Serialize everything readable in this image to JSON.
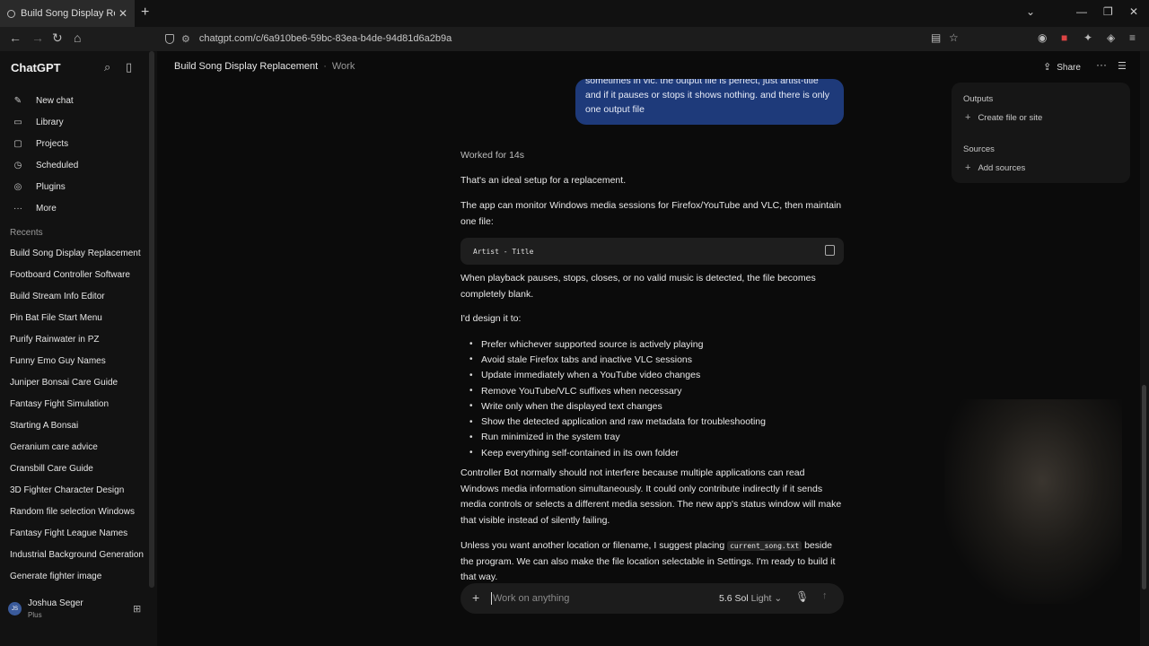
{
  "browser": {
    "tab_title": "Build Song Display Replacement",
    "url": "chatgpt.com/c/6a910be6-59bc-83ea-b4de-94d81d6a2b9a",
    "icons": [
      "back-icon",
      "forward-icon",
      "reload-icon",
      "home-icon",
      "shield-icon",
      "bookmark-icon",
      "star-icon"
    ]
  },
  "sidebar": {
    "brand": "ChatGPT",
    "nav": [
      {
        "label": "New chat",
        "icon": "edit-icon"
      },
      {
        "label": "Library",
        "icon": "library-icon"
      },
      {
        "label": "Projects",
        "icon": "folder-icon"
      },
      {
        "label": "Scheduled",
        "icon": "clock-icon"
      },
      {
        "label": "Plugins",
        "icon": "plugin-icon"
      },
      {
        "label": "More",
        "icon": "more-icon"
      }
    ],
    "recents_heading": "Recents",
    "recents": [
      "Build Song Display Replacement",
      "Footboard Controller Software",
      "Build Stream Info Editor",
      "Pin Bat File Start Menu",
      "Purify Rainwater in PZ",
      "Funny Emo Guy Names",
      "Juniper Bonsai Care Guide",
      "Fantasy Fight Simulation",
      "Starting A Bonsai",
      "Geranium care advice",
      "Cransbill Care Guide",
      "3D Fighter Character Design",
      "Random file selection Windows",
      "Fantasy Fight League Names",
      "Industrial Background Generation",
      "Generate fighter image"
    ],
    "user": {
      "name": "Joshua Seger",
      "plan": "Plus",
      "initials": "JS"
    }
  },
  "header": {
    "title": "Build Song Display Replacement",
    "separator": "·",
    "project": "Work",
    "share_label": "Share"
  },
  "conversation": {
    "user_message_lines": [
      "sometimes in vlc. the output file is perfect, just artist-title",
      "and if it pauses or stops it shows nothing. and there is only",
      "one output file"
    ],
    "worked_label": "Worked for 14s",
    "p1": "That's an ideal setup for a replacement.",
    "p2": "The app can monitor Windows media sessions for Firefox/YouTube and VLC, then maintain one file:",
    "code": "Artist - Title",
    "p3": "When playback pauses, stops, closes, or no valid music is detected, the file becomes completely blank.",
    "p4": "I'd design it to:",
    "bullets": [
      "Prefer whichever supported source is actively playing",
      "Avoid stale Firefox tabs and inactive VLC sessions",
      "Update immediately when a YouTube video changes",
      "Remove YouTube/VLC suffixes when necessary",
      "Write only when the displayed text changes",
      "Show the detected application and raw metadata for troubleshooting",
      "Run minimized in the system tray",
      "Keep everything self-contained in its own folder"
    ],
    "p5": "Controller Bot normally should not interfere because multiple applications can read Windows media information simultaneously. It could only contribute indirectly if it sends media controls or selects a different media session. The new app's status window will make that visible instead of silently failing.",
    "p6_before": "Unless you want another location or filename, I suggest placing",
    "p6_code": "current_song.txt",
    "p6_after": "beside the program. We can also make the file location selectable in Settings. I'm ready to build it that way."
  },
  "composer": {
    "placeholder": "Work on anything",
    "model": "5.6 Sol",
    "mode": "Light"
  },
  "right_panel": {
    "outputs_heading": "Outputs",
    "create_label": "Create file or site",
    "sources_heading": "Sources",
    "add_sources_label": "Add sources"
  }
}
